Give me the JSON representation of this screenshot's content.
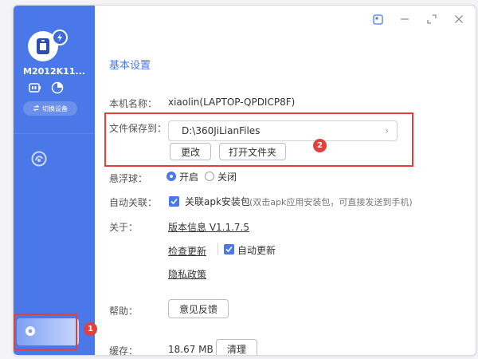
{
  "sidebar": {
    "device_name": "M2012K11...",
    "device_icon": "phone-icon",
    "switch_label": "切换设备",
    "app_icon": "app-circle-icon",
    "settings_icon": "gear-icon"
  },
  "titlebar": {
    "icons": [
      "pin-icon",
      "minimize-icon",
      "maximize-icon",
      "close-icon"
    ]
  },
  "settings": {
    "title": "基本设置",
    "device_label": "本机名称：",
    "device_value": "xiaolin(LAPTOP-QPDICP8F)",
    "save_label": "文件保存到：",
    "save_path": "D:\\360JiLianFiles",
    "change_btn": "更改",
    "open_folder_btn": "打开文件夹",
    "float_label": "悬浮球：",
    "float_on": "开启",
    "float_off": "关闭",
    "float_selected": "开启",
    "auto_label": "自动关联：",
    "auto_check_label": "关联apk安装包",
    "auto_hint": "(双击apk应用安装包，可直接发送到手机)",
    "auto_checked": true,
    "about_label": "关于：",
    "version": "版本信息 V1.1.7.5",
    "check_update": "检查更新",
    "auto_update": "自动更新",
    "auto_update_checked": true,
    "privacy": "隐私政策",
    "help_label": "帮助：",
    "feedback_btn": "意见反馈",
    "cache_label": "缓存：",
    "cache_size": "18.67 MB",
    "clear_btn": "清理"
  },
  "annotations": {
    "badge_1": "1",
    "badge_2": "2",
    "color": "#e2403c"
  },
  "colors": {
    "accent": "#4a78e8"
  }
}
